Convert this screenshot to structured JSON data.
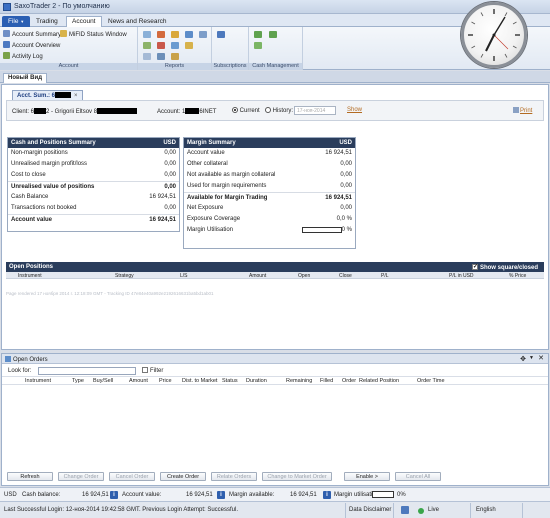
{
  "window": {
    "title": "SaxoTrader 2 - По умолчанию"
  },
  "menu_tabs": [
    {
      "label": "File",
      "caret": "▼"
    },
    {
      "label": "Trading"
    },
    {
      "label": "Account"
    },
    {
      "label": "News and Research"
    }
  ],
  "ribbon": {
    "account_group": {
      "label": "Account",
      "items": [
        "Account Summary",
        "MiFID Status Window",
        "Account Overview",
        "Activity Log"
      ]
    },
    "reports_group": {
      "label": "Reports"
    },
    "subscriptions_group": {
      "label": "Subscriptions"
    },
    "cash_group": {
      "label": "Cash Management"
    }
  },
  "view_tab": {
    "label": "Новый Вид"
  },
  "account_tab": {
    "label": "Acct. Sum.: 6",
    "close": "×"
  },
  "client_bar": {
    "client_label": "Client: 6",
    "client_name": "2 - Grigorii Eltsov 8",
    "account_label": "Account: 1",
    "account_suffix": "6INET",
    "current_label": "Current",
    "history_label": "History:",
    "history_placeholder": "17-ноя-2014",
    "show_label": "Show",
    "print_label": "Print"
  },
  "cash_positions": {
    "title": "Cash and Positions Summary",
    "currency": "USD",
    "rows": [
      {
        "label": "Non-margin positions",
        "value": "0,00"
      },
      {
        "label": "Unrealised margin profit/loss",
        "value": "0,00"
      },
      {
        "label": "Cost to close",
        "value": "0,00"
      },
      {
        "label": "Unrealised value of positions",
        "value": "0,00"
      },
      {
        "label": "Cash Balance",
        "value": "16 924,51"
      },
      {
        "label": "Transactions not booked",
        "value": "0,00"
      },
      {
        "label": "Account value",
        "value": "16 924,51"
      }
    ]
  },
  "margin_summary": {
    "title": "Margin Summary",
    "currency": "USD",
    "rows": [
      {
        "label": "Account value",
        "value": "16 924,51"
      },
      {
        "label": "Other collateral",
        "value": "0,00"
      },
      {
        "label": "Not available as margin collateral",
        "value": "0,00"
      },
      {
        "label": "Used for margin requirements",
        "value": "0,00"
      },
      {
        "label": "Available for Margin Trading",
        "value": "16 924,51"
      },
      {
        "label": "Net Exposure",
        "value": "0,00"
      },
      {
        "label": "Exposure Coverage",
        "value": "0,0 %"
      },
      {
        "label": "Margin Utilisation",
        "value": "0 %",
        "fill": 0
      }
    ]
  },
  "open_positions": {
    "title": "Open Positions",
    "show_closed_label": "Show square/closed",
    "show_closed_checked": true,
    "columns": [
      "Instrument",
      "Strategy",
      "L/S",
      "Amount",
      "Open",
      "Close",
      "P/L",
      "P/L in USD",
      "% Price"
    ]
  },
  "footnote": "Page rendered 17 ноября 2014 г. 12:18:09 GMT - Tracking ID 47e84e40a992e2192616631ba5bd1ab01",
  "open_orders": {
    "title": "Open Orders",
    "look_for_label": "Look for:",
    "filter_label": "Filter",
    "columns": [
      "Instrument",
      "Type",
      "Buy/Sell",
      "Amount",
      "Price",
      "Dist. to Market",
      "Status",
      "Duration",
      "Remaining",
      "Filled",
      "Order",
      "Related Position",
      "Order Time"
    ],
    "buttons": [
      {
        "label": "Refresh",
        "enabled": true
      },
      {
        "label": "Change Order",
        "enabled": false
      },
      {
        "label": "Cancel Order",
        "enabled": false
      },
      {
        "label": "Create Order",
        "enabled": true
      },
      {
        "label": "Relate Orders",
        "enabled": false
      },
      {
        "label": "Change to Market Order",
        "enabled": false
      },
      {
        "label": "Enable >",
        "enabled": true
      },
      {
        "label": "Cancel All",
        "enabled": false
      }
    ]
  },
  "status_bar": {
    "currency": "USD",
    "cash_balance_label": "Cash balance:",
    "cash_balance_value": "16 924,51",
    "account_value_label": "Account value:",
    "account_value_value": "16 924,51",
    "margin_available_label": "Margin available:",
    "margin_available_value": "16 924,51",
    "margin_util_label": "Margin utilisation:",
    "margin_util_value": "0%",
    "margin_util_fill": 0
  },
  "bottom_bar": {
    "last_login": "Last Successful Login: 12-ноя-2014 19:42:58 GMT. Previous Login Attempt: Successful.",
    "data_disclaimer": "Data Disclaimer",
    "live_label": "Live",
    "language": "English"
  },
  "colors": {
    "header_navy": "#2a3d5c",
    "accent_blue": "#2b5fb3"
  },
  "icons": [
    "window-app-icon",
    "clock-icon",
    "print-icon",
    "info-icon"
  ]
}
